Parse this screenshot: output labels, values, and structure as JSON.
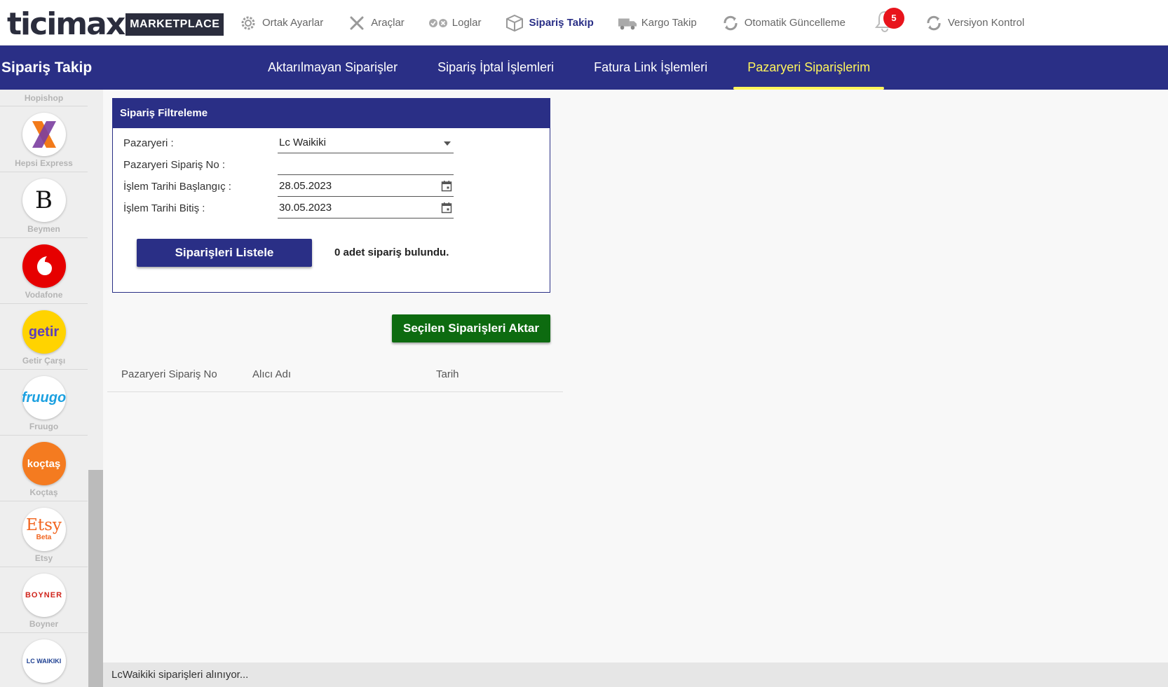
{
  "brand": {
    "logo_text": "ticimax",
    "badge_text": "MARKETPLACE"
  },
  "top_nav": {
    "items": [
      {
        "label": "Ortak Ayarlar",
        "icon": "gear-icon"
      },
      {
        "label": "Araçlar",
        "icon": "tools-icon"
      },
      {
        "label": "Loglar",
        "icon": "logs-icon"
      },
      {
        "label": "Sipariş Takip",
        "icon": "box-icon",
        "active": true
      },
      {
        "label": "Kargo Takip",
        "icon": "truck-icon"
      },
      {
        "label": "Otomatik Güncelleme",
        "icon": "refresh-icon"
      }
    ],
    "notifications": {
      "count": "5",
      "icon": "bell-icon"
    },
    "version": {
      "label": "Versiyon Kontrol",
      "icon": "refresh-icon"
    }
  },
  "subnav": {
    "title": "Sipariş Takip",
    "tabs": [
      {
        "label": "Aktarılmayan Siparişler"
      },
      {
        "label": "Sipariş İptal İşlemleri"
      },
      {
        "label": "Fatura Link İşlemleri"
      },
      {
        "label": "Pazaryeri Siparişlerim",
        "active": true
      }
    ]
  },
  "sidebar": {
    "items": [
      {
        "label": "Hopishop"
      },
      {
        "label": "Hepsi Express",
        "logo_text": "X"
      },
      {
        "label": "Beymen",
        "logo_text": "B"
      },
      {
        "label": "Vodafone"
      },
      {
        "label": "Getir Çarşı",
        "logo_text": "getir"
      },
      {
        "label": "Fruugo",
        "logo_text": "fruugo"
      },
      {
        "label": "Koçtaş",
        "logo_text": "koçtaş"
      },
      {
        "label": "Etsy",
        "logo_text": "Etsy",
        "logo_sub": "Beta"
      },
      {
        "label": "Boyner",
        "logo_text": "BOYNER"
      },
      {
        "label": "LC Waikiki",
        "logo_text": "LC WAIKIKI"
      }
    ]
  },
  "filter": {
    "title": "Sipariş Filtreleme",
    "marketplace_label": "Pazaryeri :",
    "marketplace_value": "Lc Waikiki",
    "order_no_label": "Pazaryeri Sipariş No :",
    "order_no_value": "",
    "start_label": "İşlem Tarihi Başlangıç :",
    "start_value": "28.05.2023",
    "end_label": "İşlem Tarihi Bitiş :",
    "end_value": "30.05.2023",
    "list_button": "Siparişleri Listele",
    "result_text": "0 adet sipariş bulundu."
  },
  "transfer_button": "Seçilen Siparişleri Aktar",
  "table": {
    "columns": [
      "Pazaryeri Sipariş No",
      "Alıcı Adı",
      "Tarih"
    ],
    "rows": []
  },
  "status": {
    "text": "LcWaikiki siparişleri alınıyor..."
  },
  "colors": {
    "primary": "#2a2f86",
    "accent": "#fff55c",
    "success": "#0d6b10",
    "badge": "#e8141c"
  }
}
